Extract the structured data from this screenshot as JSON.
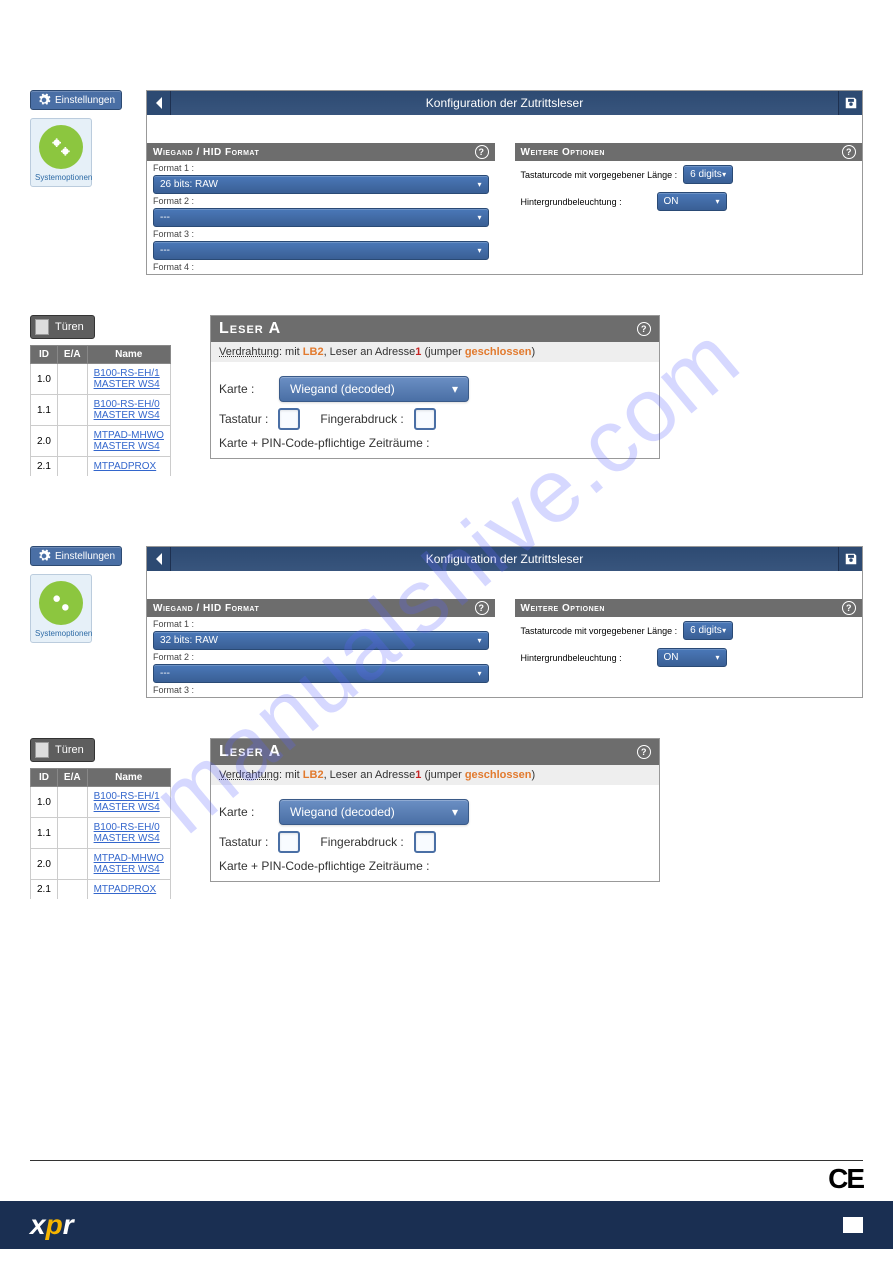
{
  "watermark": "manualshive.com",
  "settings": {
    "label": "Einstellungen",
    "sysopt": "Systemoptionen"
  },
  "panel1": {
    "title": "Konfiguration der Zutrittsleser",
    "left_header": "Wiegand / HID Format",
    "right_header": "Weitere Optionen",
    "f1_lbl": "Format 1 :",
    "f1": "26 bits: RAW",
    "f2_lbl": "Format 2 :",
    "f2": "---",
    "f3_lbl": "Format 3 :",
    "f3": "---",
    "f4_lbl": "Format 4 :",
    "opt1_lbl": "Tastaturcode mit vorgegebener Länge :",
    "opt1": "6 digits",
    "opt2_lbl": "Hintergrundbeleuchtung :",
    "opt2": "ON"
  },
  "panel2": {
    "title": "Konfiguration der Zutrittsleser",
    "left_header": "Wiegand / HID Format",
    "right_header": "Weitere Optionen",
    "f1_lbl": "Format 1 :",
    "f1": "32 bits: RAW",
    "f2_lbl": "Format 2 :",
    "f2": "---",
    "f3_lbl": "Format 3 :",
    "opt1_lbl": "Tastaturcode mit vorgegebener Länge :",
    "opt1": "6 digits",
    "opt2_lbl": "Hintergrundbeleuchtung :",
    "opt2": "ON"
  },
  "doors": {
    "tab": "Türen",
    "th": {
      "id": "ID",
      "ea": "E/A",
      "name": "Name"
    },
    "rows": [
      {
        "id": "1.0",
        "name1": "B100-RS-EH/1",
        "name2": "MASTER WS4"
      },
      {
        "id": "1.1",
        "name1": "B100-RS-EH/0",
        "name2": "MASTER WS4"
      },
      {
        "id": "2.0",
        "name1": "MTPAD-MHWO",
        "name2": "MASTER WS4"
      },
      {
        "id": "2.1",
        "name1": "MTPADPROX",
        "name2": ""
      }
    ]
  },
  "leser": {
    "title": "Leser A",
    "wiring_lbl": "Verdrahtung",
    "wiring_pre": ": mit ",
    "lb2": "LB2",
    "wiring_mid": ", Leser an Adresse",
    "addr": "1",
    "wiring_post1": " (jumper ",
    "jumper": "geschlossen",
    "wiring_post2": ")",
    "karte_lbl": "Karte :",
    "karte_val": "Wiegand (decoded)",
    "tastatur_lbl": "Tastatur :",
    "finger_lbl": "Fingerabdruck :",
    "pin_lbl": "Karte + PIN-Code-pflichtige Zeiträume :"
  },
  "ce": "CE"
}
